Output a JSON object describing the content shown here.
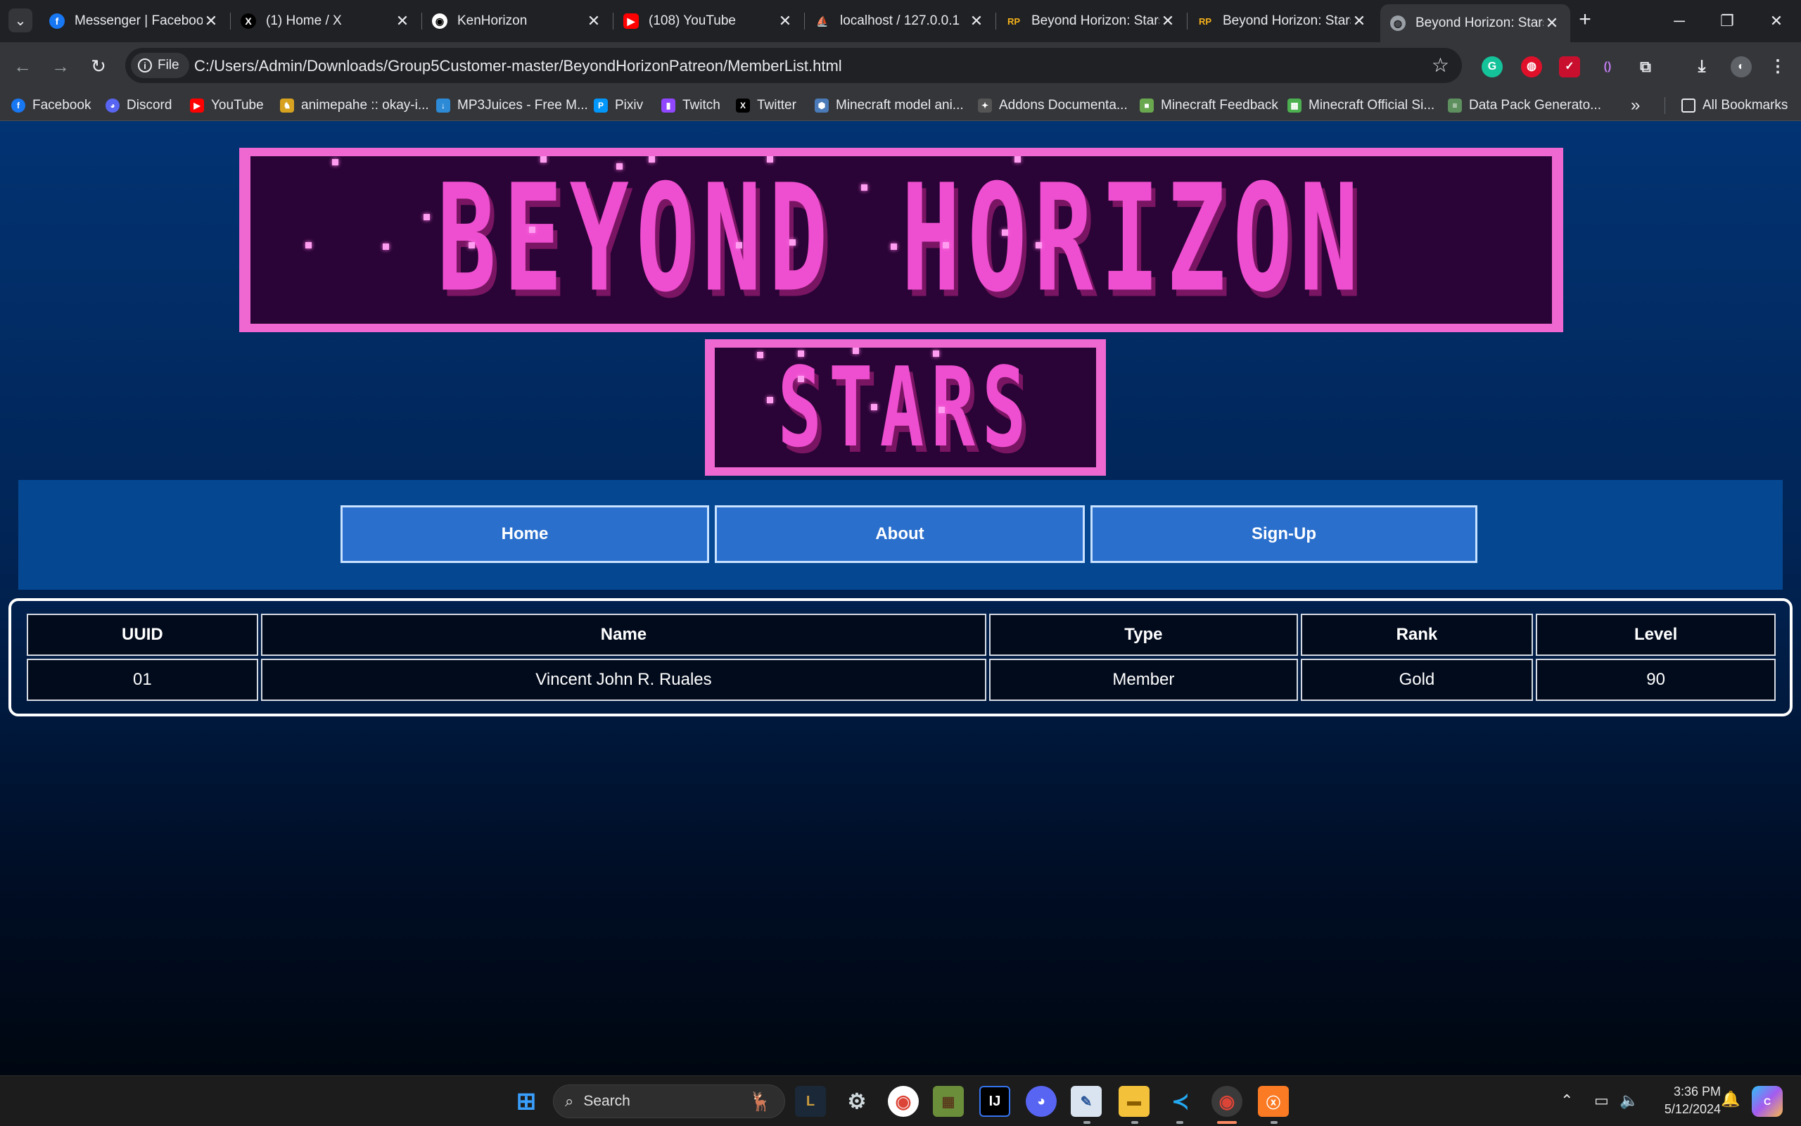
{
  "browser": {
    "tabs": [
      {
        "title": "Messenger | Facebook",
        "icon": "facebook-icon",
        "color": "#1877f2",
        "glyph": "f"
      },
      {
        "title": "(1) Home / X",
        "icon": "x-icon",
        "color": "#000000",
        "glyph": "X"
      },
      {
        "title": "KenHorizon",
        "icon": "github-icon",
        "color": "#ffffff",
        "glyph": "◉"
      },
      {
        "title": "(108) YouTube",
        "icon": "youtube-icon",
        "color": "#ff0000",
        "glyph": "▶"
      },
      {
        "title": "localhost / 127.0.0.1",
        "icon": "phpmyadmin-icon",
        "color": "#f29111",
        "glyph": "⛵"
      },
      {
        "title": "Beyond Horizon: Stars",
        "icon": "rp-icon",
        "color": "#f7b21b",
        "glyph": "RP"
      },
      {
        "title": "Beyond Horizon: Stars",
        "icon": "rp-icon",
        "color": "#f7b21b",
        "glyph": "RP"
      },
      {
        "title": "Beyond Horizon: Stars",
        "icon": "globe-icon",
        "color": "#9aa0a6",
        "glyph": "◍"
      }
    ],
    "new_tab": "+",
    "file_chip": "File",
    "url": "C:/Users/Admin/Downloads/Group5Customer-master/BeyondHorizonPatreon/MemberList.html",
    "bookmarks": [
      {
        "label": "Facebook",
        "icon": "facebook-icon",
        "color": "#1877f2",
        "glyph": "f"
      },
      {
        "label": "Discord",
        "icon": "discord-icon",
        "color": "#5865f2",
        "glyph": "◕"
      },
      {
        "label": "YouTube",
        "icon": "youtube-icon",
        "color": "#ff0000",
        "glyph": "▶"
      },
      {
        "label": "animepahe :: okay-i...",
        "icon": "animepahe-icon",
        "color": "#d6a21f",
        "glyph": "♞"
      },
      {
        "label": "MP3Juices - Free M...",
        "icon": "download-icon",
        "color": "#2d8ad6",
        "glyph": "↓"
      },
      {
        "label": "Pixiv",
        "icon": "pixiv-icon",
        "color": "#0096fa",
        "glyph": "P"
      },
      {
        "label": "Twitch",
        "icon": "twitch-icon",
        "color": "#9146ff",
        "glyph": "▮"
      },
      {
        "label": "Twitter",
        "icon": "x-icon",
        "color": "#000000",
        "glyph": "X"
      },
      {
        "label": "Minecraft model ani...",
        "icon": "cube-icon",
        "color": "#4a7bb8",
        "glyph": "⬢"
      },
      {
        "label": "Addons Documenta...",
        "icon": "addons-icon",
        "color": "#555555",
        "glyph": "✦"
      },
      {
        "label": "Minecraft Feedback",
        "icon": "grass-block-icon",
        "color": "#6aa84f",
        "glyph": "■"
      },
      {
        "label": "Minecraft Official Si...",
        "icon": "creeper-icon",
        "color": "#4caf50",
        "glyph": "▦"
      },
      {
        "label": "Data Pack Generato...",
        "icon": "datapack-icon",
        "color": "#5e8f5e",
        "glyph": "≡"
      }
    ],
    "overflow": "»",
    "all_bookmarks": "All Bookmarks"
  },
  "site": {
    "logo_title": "BEYOND HORIZON",
    "logo_subtitle": "STARS",
    "nav": [
      {
        "label": "Home"
      },
      {
        "label": "About"
      },
      {
        "label": "Sign-Up"
      }
    ],
    "table": {
      "headers": [
        "UUID",
        "Name",
        "Type",
        "Rank",
        "Level"
      ],
      "rows": [
        [
          "01",
          "Vincent John R. Ruales",
          "Member",
          "Gold",
          "90"
        ]
      ]
    }
  },
  "taskbar": {
    "search_label": "Search",
    "time": "3:36 PM",
    "date": "5/12/2024"
  },
  "colors": {
    "logo_pink": "#ef67d0",
    "logo_dark": "#2a0436",
    "nav_bar": "#054791",
    "nav_button": "#2a6fcc",
    "page_top": "#023373",
    "page_bottom": "#000711"
  }
}
